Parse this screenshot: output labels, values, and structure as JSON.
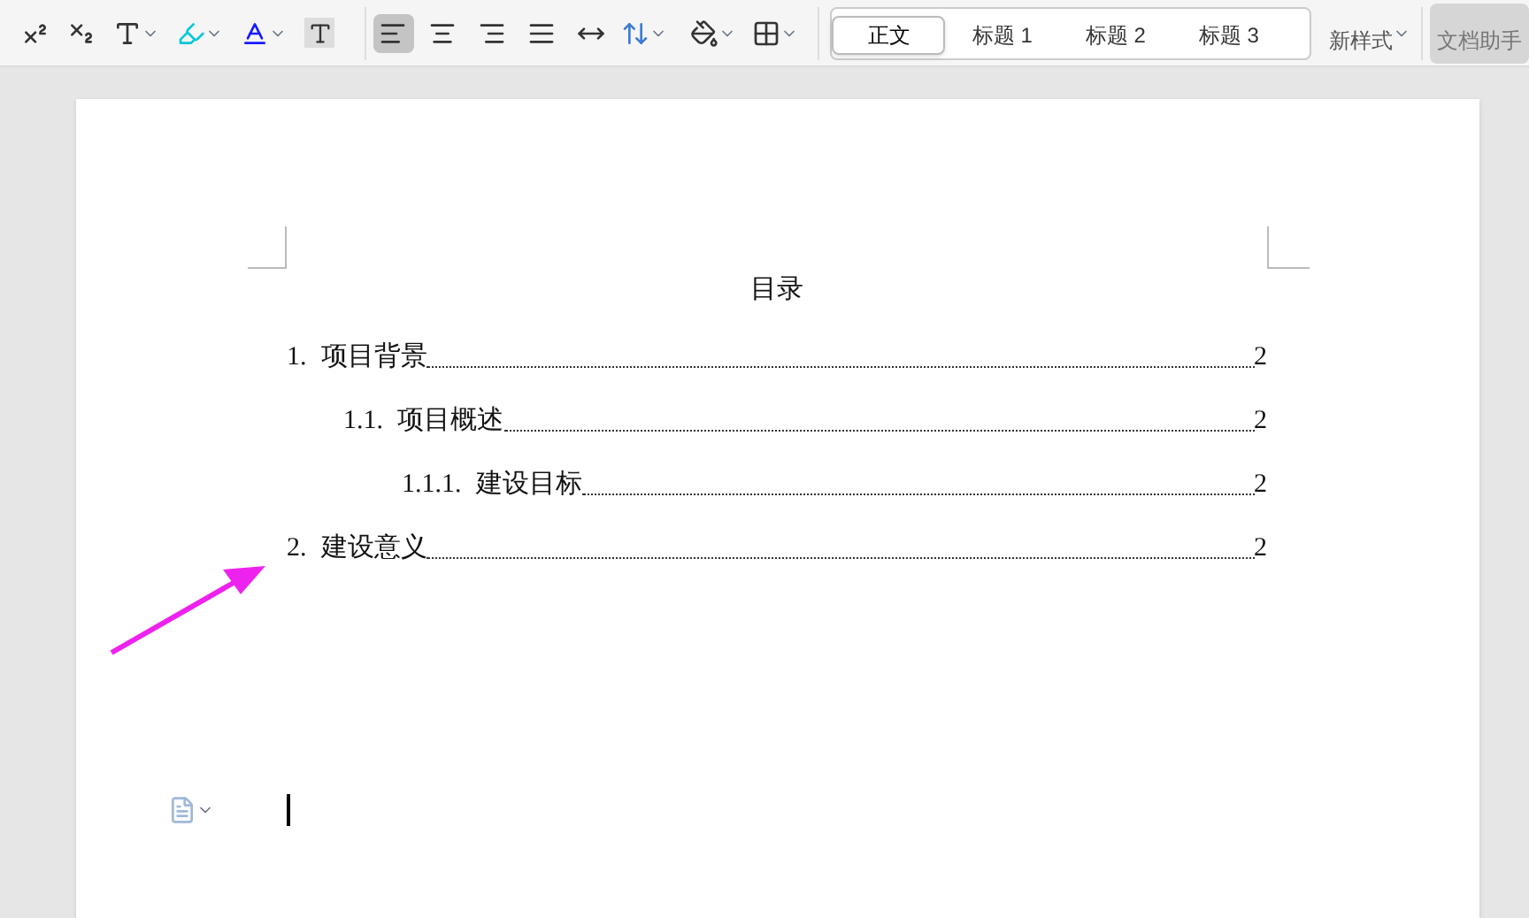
{
  "toolbar": {
    "align_buttons": [
      {
        "kind": "left",
        "selected": true
      },
      {
        "kind": "center",
        "selected": false
      },
      {
        "kind": "right",
        "selected": false
      },
      {
        "kind": "justify",
        "selected": false
      },
      {
        "kind": "distribute",
        "selected": false
      }
    ],
    "styles": [
      {
        "label": "正文",
        "selected": true
      },
      {
        "label": "标题 1",
        "selected": false
      },
      {
        "label": "标题 2",
        "selected": false
      },
      {
        "label": "标题 3",
        "selected": false
      }
    ],
    "new_style": "新样式",
    "assistant": "文档助手"
  },
  "toc": {
    "title": "目录",
    "entries": [
      {
        "number": "1.",
        "text": "项目背景",
        "page": "2",
        "children": [
          {
            "number": "1.1.",
            "text": "项目概述",
            "page": "2",
            "children": [
              {
                "number": "1.1.1.",
                "text": "建设目标",
                "page": "2"
              }
            ]
          }
        ]
      },
      {
        "number": "2.",
        "text": "建设意义",
        "page": "2"
      }
    ]
  }
}
